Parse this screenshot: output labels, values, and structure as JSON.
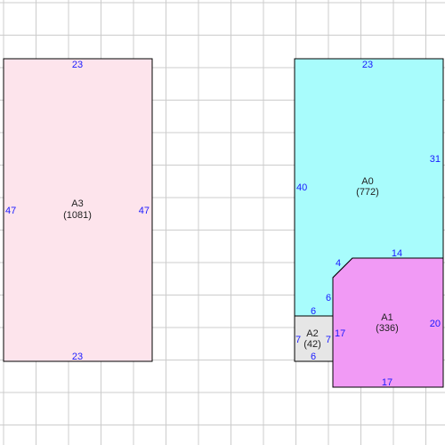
{
  "colors": {
    "grid": "#cccccc",
    "outline": "#000000",
    "dimension_text": "#1a1aff",
    "A0": "#a8fcfc",
    "A1": "#f19af5",
    "A2": "#e6e6e6",
    "A3": "#fde4ec"
  },
  "rooms": {
    "A0": {
      "name": "A0",
      "area": "(772)"
    },
    "A1": {
      "name": "A1",
      "area": "(336)"
    },
    "A2": {
      "name": "A2",
      "area": "(42)"
    },
    "A3": {
      "name": "A3",
      "area": "(1081)"
    }
  },
  "dimensions": {
    "A3": {
      "top": "23",
      "bottom": "23",
      "left": "47",
      "right": "47"
    },
    "A0": {
      "top": "23",
      "left": "40",
      "right": "31"
    },
    "A1": {
      "top": "14",
      "chamfer": "4",
      "left": "6",
      "left_lower": "17",
      "right": "20",
      "bottom": "17"
    },
    "A2": {
      "top": "6",
      "left": "7",
      "right": "7",
      "bottom": "6"
    }
  }
}
